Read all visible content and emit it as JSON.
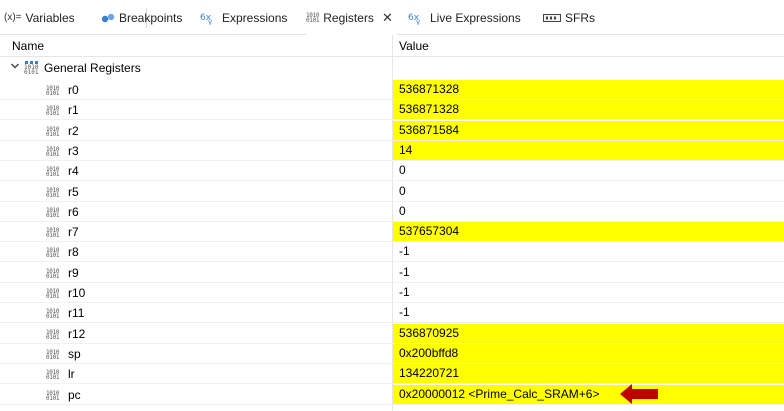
{
  "tabs": [
    {
      "icon": "variables-icon",
      "prefix": "(x)=",
      "label": "Variables"
    },
    {
      "icon": "breakpoints-icon",
      "label": "Breakpoints"
    },
    {
      "icon": "expressions-icon",
      "label": "Expressions"
    },
    {
      "icon": "registers-icon",
      "label": "Registers",
      "active": true,
      "close": "✕"
    },
    {
      "icon": "live-expressions-icon",
      "label": "Live Expressions"
    },
    {
      "icon": "sfrs-icon",
      "label": "SFRs"
    }
  ],
  "columns": {
    "name": "Name",
    "value": "Value"
  },
  "group": {
    "label": "General Registers",
    "expanded": true
  },
  "registers": [
    {
      "name": "r0",
      "value": "536871328",
      "highlight": true
    },
    {
      "name": "r1",
      "value": "536871328",
      "highlight": true
    },
    {
      "name": "r2",
      "value": "536871584",
      "highlight": true
    },
    {
      "name": "r3",
      "value": "14",
      "highlight": true
    },
    {
      "name": "r4",
      "value": "0",
      "highlight": false
    },
    {
      "name": "r5",
      "value": "0",
      "highlight": false
    },
    {
      "name": "r6",
      "value": "0",
      "highlight": false
    },
    {
      "name": "r7",
      "value": "537657304",
      "highlight": true
    },
    {
      "name": "r8",
      "value": "-1",
      "highlight": false
    },
    {
      "name": "r9",
      "value": "-1",
      "highlight": false
    },
    {
      "name": "r10",
      "value": "-1",
      "highlight": false
    },
    {
      "name": "r11",
      "value": "-1",
      "highlight": false
    },
    {
      "name": "r12",
      "value": "536870925",
      "highlight": true
    },
    {
      "name": "sp",
      "value": "0x200bffd8",
      "highlight": true
    },
    {
      "name": "lr",
      "value": "134220721",
      "highlight": true
    },
    {
      "name": "pc",
      "value": "0x20000012 <Prime_Calc_SRAM+6>",
      "highlight": true
    }
  ],
  "colors": {
    "highlight": "#ffff00",
    "arrow": "#c00000"
  }
}
